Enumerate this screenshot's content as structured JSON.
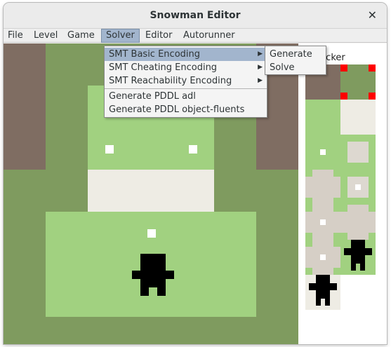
{
  "window": {
    "title": "Snowman Editor"
  },
  "menubar": {
    "items": [
      "File",
      "Level",
      "Game",
      "Solver",
      "Editor",
      "Autorunner"
    ]
  },
  "solver_menu": {
    "items": [
      {
        "label": "SMT Basic Encoding",
        "has_submenu": true,
        "highlighted": true
      },
      {
        "label": "SMT Cheating Encoding",
        "has_submenu": true
      },
      {
        "label": "SMT Reachability Encoding",
        "has_submenu": true
      },
      {
        "label": "Generate PDDL adl"
      },
      {
        "label": "Generate PDDL object-fluents"
      }
    ],
    "arrow": "▶"
  },
  "submenu": {
    "items": [
      "Generate",
      "Solve"
    ]
  },
  "picker": {
    "label_visible": "Picker"
  },
  "colors": {
    "grass": "#a1d180",
    "dark_grass": "#7f9b5f",
    "dirt": "#7f6d62",
    "snow": "#eeece4",
    "highlight": "#a2b5cd",
    "picker_marker": "#ff0000"
  }
}
